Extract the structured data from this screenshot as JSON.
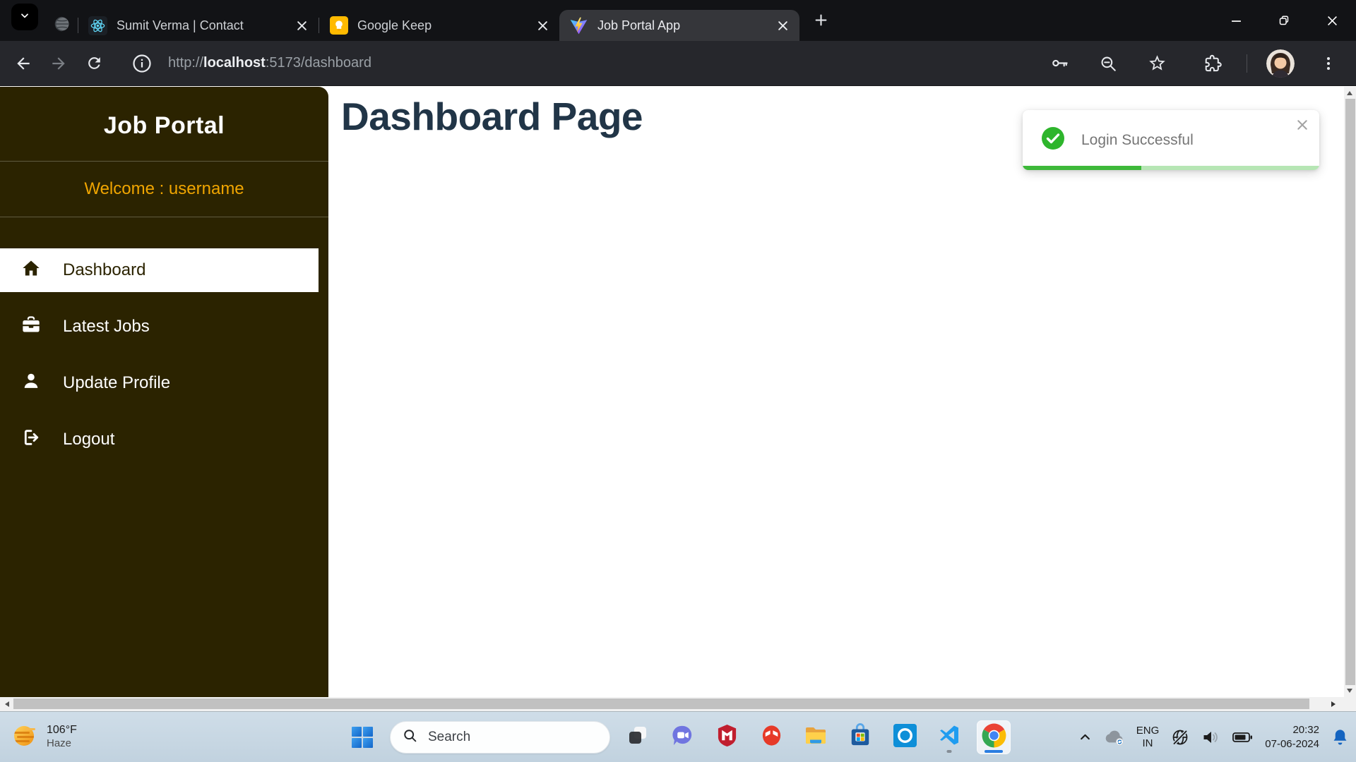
{
  "browser": {
    "tabs": [
      {
        "title": "Sumit Verma | Contact",
        "favicon": "react-icon",
        "active": false
      },
      {
        "title": "Google Keep",
        "favicon": "google-keep-icon",
        "active": false
      },
      {
        "title": "Job Portal App",
        "favicon": "vite-icon",
        "active": true
      }
    ],
    "address": {
      "protocol": "http://",
      "host": "localhost",
      "path": ":5173/dashboard"
    }
  },
  "page": {
    "sidebar": {
      "title": "Job Portal",
      "welcome": "Welcome : username",
      "items": [
        {
          "label": "Dashboard",
          "icon": "home-icon",
          "active": true
        },
        {
          "label": "Latest Jobs",
          "icon": "briefcase-icon",
          "active": false
        },
        {
          "label": "Update Profile",
          "icon": "user-icon",
          "active": false
        },
        {
          "label": "Logout",
          "icon": "logout-icon",
          "active": false
        }
      ]
    },
    "main": {
      "heading": "Dashboard Page"
    },
    "toast": {
      "message": "Login Successful",
      "progress_percent": 40
    }
  },
  "taskbar": {
    "weather": {
      "temperature": "106°F",
      "condition": "Haze"
    },
    "search": {
      "placeholder": "Search"
    },
    "apps": [
      "task-view",
      "chat",
      "mcafee",
      "webadvisor",
      "file-explorer",
      "microsoft-store",
      "alexa",
      "vscode",
      "chrome"
    ],
    "active_app": "chrome",
    "tray": {
      "language": {
        "line1": "ENG",
        "line2": "IN"
      },
      "time": "20:32",
      "date": "07-06-2024"
    }
  },
  "colors": {
    "sidebar_bg": "#2b2300",
    "welcome_orange": "#f0a500",
    "heading": "#213547",
    "toast_green": "#2eb52c",
    "active_tab_bg": "#35363a",
    "taskbar_bg": "#c9d8e4",
    "taskbar_accent": "#2a7de1"
  }
}
